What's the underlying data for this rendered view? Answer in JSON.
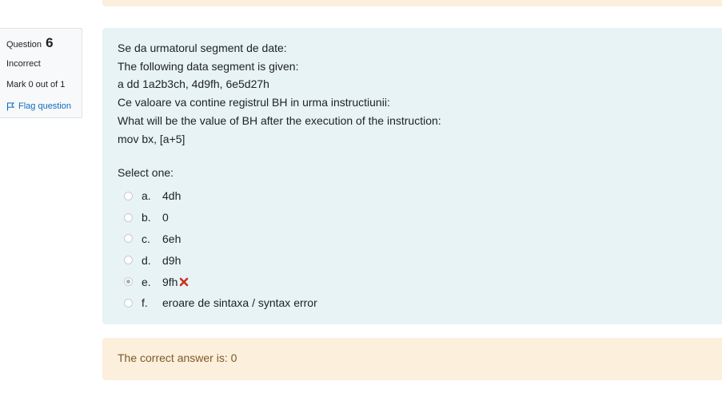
{
  "question_info": {
    "label": "Question",
    "number": "6",
    "state": "Incorrect",
    "grade": "Mark 0 out of 1",
    "flag_label": "Flag question"
  },
  "question_text": {
    "lines": [
      "Se da urmatorul segment de date:",
      "The following data segment is given:",
      "a dd 1a2b3ch, 4d9fh, 6e5d27h",
      "Ce valoare va contine registrul BH in urma instructiunii:",
      "What will be the value of BH after the execution of the instruction:",
      "mov bx, [a+5]"
    ]
  },
  "answer_block": {
    "prompt": "Select one:",
    "options": [
      {
        "letter": "a.",
        "text": "4dh",
        "selected": false
      },
      {
        "letter": "b.",
        "text": "0",
        "selected": false
      },
      {
        "letter": "c.",
        "text": "6eh",
        "selected": false
      },
      {
        "letter": "d.",
        "text": "d9h",
        "selected": false
      },
      {
        "letter": "e.",
        "text": "9fh",
        "selected": true,
        "incorrect_mark": "x-icon"
      },
      {
        "letter": "f.",
        "text": "eroare de sintaxa / syntax error",
        "selected": false
      }
    ]
  },
  "feedback": {
    "right_answer": "The correct answer is: 0"
  },
  "colors": {
    "formulation_bg": "#e7f3f5",
    "outcome_bg": "#fcefdc",
    "outcome_text": "#7d5a29",
    "link": "#0f6cbf",
    "incorrect": "#ca3120"
  }
}
